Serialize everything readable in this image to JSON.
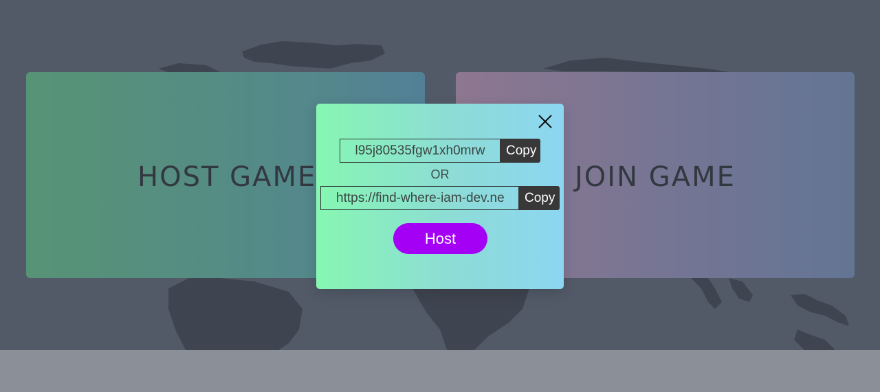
{
  "cards": {
    "host_title": "HOST GAME",
    "join_title": "JOIN GAME"
  },
  "modal": {
    "game_code": "l95j80535fgw1xh0mrw",
    "copy_code_label": "Copy",
    "or_label": "OR",
    "game_url": "https://find-where-iam-dev.ne",
    "copy_url_label": "Copy",
    "host_button_label": "Host",
    "close_icon": "close-icon"
  },
  "colors": {
    "background": "#525a68",
    "footer": "#8b9098",
    "host_button": "#a400f5",
    "copy_button": "#383838"
  }
}
